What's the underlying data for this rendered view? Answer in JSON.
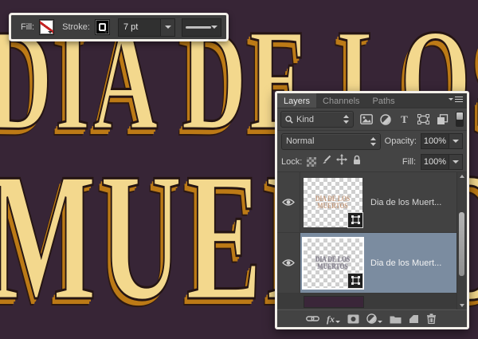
{
  "canvas": {
    "title_line1": "DIA DE LOS",
    "title_line2": "MUERTOS",
    "colors": {
      "background": "#372536",
      "letter_fill": "#f3d88d",
      "letter_outline": "#251513",
      "stitch": "#bc7a16"
    }
  },
  "options_bar": {
    "fill_label": "Fill:",
    "stroke_label": "Stroke:",
    "stroke_size": "7 pt"
  },
  "layers_panel": {
    "tabs": [
      {
        "label": "Layers"
      },
      {
        "label": "Channels"
      },
      {
        "label": "Paths"
      }
    ],
    "filter_kind": "Kind",
    "blend_mode": "Normal",
    "opacity_label": "Opacity:",
    "opacity_value": "100%",
    "lock_label": "Lock:",
    "fill_label": "Fill:",
    "fill_value": "100%",
    "selected_row_color": "#7b8ca0",
    "layers": [
      {
        "name": "Dia de los Muert...",
        "thumb_line1": "DIA DE LOS",
        "thumb_line2": "MUERTOS",
        "selected": false
      },
      {
        "name": "Dia de los Muert...",
        "thumb_line1": "DIA DE LOS",
        "thumb_line2": "MUERTOS",
        "selected": true
      }
    ],
    "bottom_bar": {
      "fx_label": "fx"
    }
  }
}
